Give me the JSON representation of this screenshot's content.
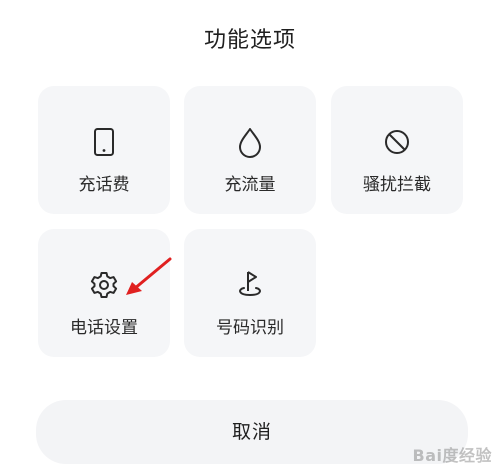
{
  "dialog": {
    "title": "功能选项",
    "cancel_label": "取消"
  },
  "options": [
    {
      "label": "充话费",
      "icon": "phone-icon"
    },
    {
      "label": "充流量",
      "icon": "water-drop-icon"
    },
    {
      "label": "骚扰拦截",
      "icon": "block-icon"
    },
    {
      "label": "电话设置",
      "icon": "gear-icon"
    },
    {
      "label": "号码识别",
      "icon": "flag-pin-icon"
    }
  ],
  "watermark": {
    "text": "Bai度经验"
  },
  "colors": {
    "tile_bg": "#f5f6f8",
    "annotation_arrow": "#e02020"
  }
}
